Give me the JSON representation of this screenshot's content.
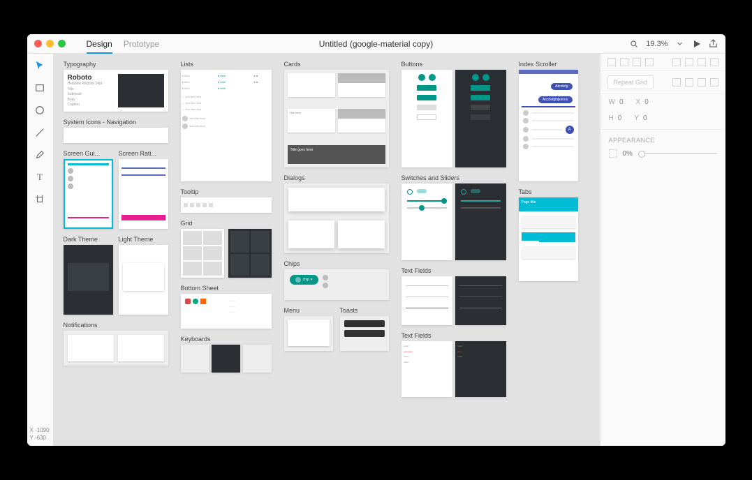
{
  "tabs": {
    "design": "Design",
    "prototype": "Prototype"
  },
  "document_title": "Untitled (google-material copy)",
  "zoom": "19.3%",
  "tools": [
    "select",
    "rectangle",
    "ellipse",
    "line",
    "pen",
    "text",
    "artboard"
  ],
  "coords": {
    "x_label": "X",
    "x": "-1090",
    "y_label": "Y",
    "y": "-630"
  },
  "artboards": {
    "typography": "Typography",
    "sysicons": "System Icons - Navigation",
    "screen_guide": "Screen Gui...",
    "screen_ratio": "Screen Rati...",
    "dark_theme": "Dark Theme",
    "light_theme": "Light Theme",
    "notifications": "Notifications",
    "lists": "Lists",
    "tooltip": "Tooltip",
    "grid": "Grid",
    "bottom_sheet": "Bottom Sheet",
    "keyboards": "Keyboards",
    "cards": "Cards",
    "dialogs": "Dialogs",
    "chips": "Chips",
    "menu": "Menu",
    "toasts": "Toasts",
    "buttons": "Buttons",
    "switches": "Switches and Sliders",
    "text_fields": "Text Fields",
    "text_fields2": "Text Fields",
    "index_scroller": "Index Scroller",
    "tabs_art": "Tabs"
  },
  "thumbs": {
    "roboto": "Roboto",
    "card_title": "Title goes here",
    "scroller_chip1": "Abcdefg",
    "scroller_chip2": "Abcdefghijklmno",
    "scroller_letter": "A",
    "tabs_title": "Page title"
  },
  "inspector": {
    "repeat_grid": "Repeat Grid",
    "w_label": "W",
    "w_value": "0",
    "x_label": "X",
    "x_value": "0",
    "h_label": "H",
    "h_value": "0",
    "y_label": "Y",
    "y_value": "0",
    "appearance": "APPEARANCE",
    "opacity": "0%"
  }
}
